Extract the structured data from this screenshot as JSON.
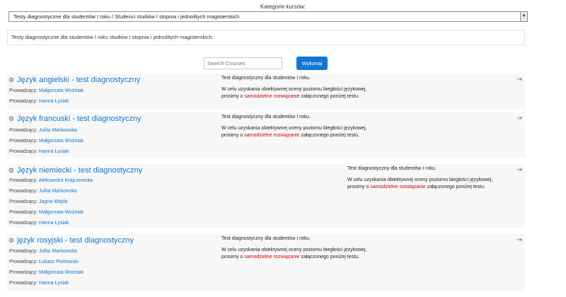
{
  "category": {
    "label": "Kategorie kursów:",
    "selected": "Testy diagnostyczne dla studentów I roku / Studenci studiów I stopnia i jednolitych magisterskich",
    "description": "Testy diagnostyczne dla studentów I roku studiów I stopnia i jednolitych magisterskich."
  },
  "search": {
    "placeholder": "Search Courses",
    "button": "Wykonaj"
  },
  "teacher_label": "Prowadzący:",
  "summary": {
    "line1": "Test diagnostyczny dla studentów I roku.",
    "line2": "W celu uzyskania obiektywnej oceny poziomu biegłości językowej,",
    "line3a": "prosimy o ",
    "line3b": "samodzielne rozwiązanie",
    "line3c": " załączonego poniżej testu."
  },
  "courses": [
    {
      "title": "Język angielski - test diagnostyczny",
      "teachers": [
        "Małgorzata Woźniak",
        "Hanna Łysiak"
      ]
    },
    {
      "title": "Język francuski - test diagnostyczny",
      "teachers": [
        "Julita Markowska",
        "Małgorzata Woźniak",
        "Hanna Łysiak"
      ]
    },
    {
      "title": "Język niemiecki - test diagnostyczny",
      "teachers": [
        "Aleksandra Krajczewska",
        "Julita Markowska",
        "Jagna Wajda",
        "Małgorzata Woźniak",
        "Hanna Łysiak"
      ]
    },
    {
      "title": "język rosyjski - test diagnostyczny",
      "teachers": [
        "Julita Markowska",
        "Łukasz Piotrowski",
        "Małgorzata Woźniak",
        "Hanna Łysiak"
      ]
    }
  ]
}
